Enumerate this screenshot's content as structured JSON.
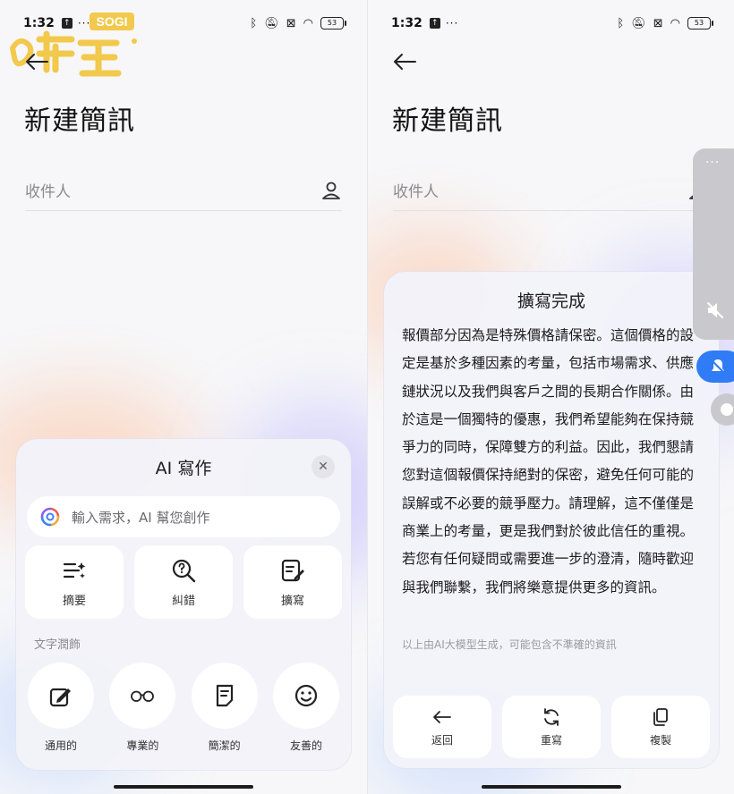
{
  "status_bar": {
    "time": "1:32",
    "battery": "53",
    "dots": "···"
  },
  "compose": {
    "title": "新建簡訊",
    "recipient_label": "收件人"
  },
  "watermark": {
    "text": "SOGI",
    "brand": "手機王"
  },
  "ai_sheet": {
    "title": "AI 寫作",
    "close_glyph": "✕",
    "input_placeholder": "輸入需求，AI 幫您創作",
    "actions": [
      {
        "label": "摘要",
        "icon": "summary-icon"
      },
      {
        "label": "糾錯",
        "icon": "proofread-icon"
      },
      {
        "label": "擴寫",
        "icon": "expand-write-icon"
      }
    ],
    "section_label": "文字潤飾",
    "styles": [
      {
        "label": "通用的",
        "icon": "pen-icon"
      },
      {
        "label": "專業的",
        "icon": "glasses-icon"
      },
      {
        "label": "簡潔的",
        "icon": "document-icon"
      },
      {
        "label": "友善的",
        "icon": "smiley-icon"
      }
    ]
  },
  "result_card": {
    "title": "擴寫完成",
    "body": "報價部分因為是特殊價格請保密。這個價格的設定是基於多種因素的考量，包括市場需求、供應鏈狀況以及我們與客戶之間的長期合作關係。由於這是一個獨特的優惠，我們希望能夠在保持競爭力的同時，保障雙方的利益。因此，我們懇請您對這個報價保持絕對的保密，避免任何可能的誤解或不必要的競爭壓力。請理解，這不僅僅是商業上的考量，更是我們對於彼此信任的重視。若您有任何疑問或需要進一步的澄清，隨時歡迎與我們聯繫，我們將樂意提供更多的資訊。",
    "note": "以上由AI大模型生成，可能包含不準確的資訊",
    "buttons": [
      {
        "label": "返回",
        "icon": "back-arrow-icon"
      },
      {
        "label": "重寫",
        "icon": "refresh-icon"
      },
      {
        "label": "複製",
        "icon": "copy-icon"
      }
    ]
  },
  "colors": {
    "accent": "#2f7cf6",
    "sheet_bg": "#f3f3f9",
    "text": "#1c1c1e",
    "muted": "#8a8a90",
    "logo_yellow": "#f2c94c"
  }
}
